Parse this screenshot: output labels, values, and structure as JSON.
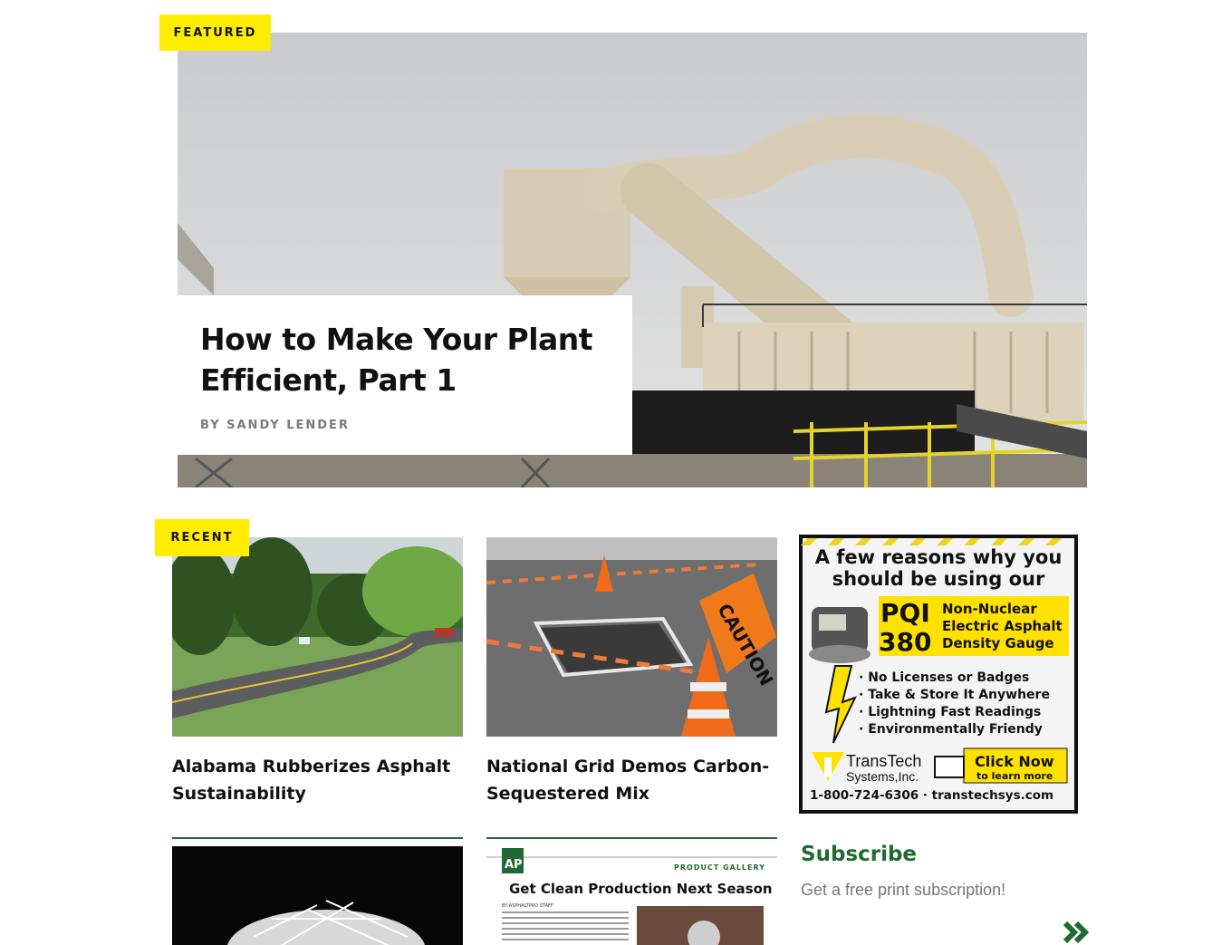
{
  "featured": {
    "tag": "Featured",
    "title": "How to Make Your Plant Efficient, Part 1",
    "byline": "By Sandy Lender"
  },
  "recent": {
    "tag": "Recent",
    "articles": [
      {
        "title": "Alabama Rubberizes Asphalt Sustainability"
      },
      {
        "title": "National Grid Demos Carbon-Sequestered Mix"
      }
    ],
    "more_thumbs": [
      {
        "alt": "fiber-image"
      },
      {
        "badge": "AP",
        "label": "PRODUCT GALLERY",
        "headline": "Get Clean Production Next Season",
        "byline": "BY ASPHALTPRO STAFF"
      }
    ]
  },
  "ad": {
    "headline_line1": "A few reasons why you",
    "headline_line2": "should be using our",
    "model": "PQI",
    "model_number": "380",
    "product_line1": "Non-Nuclear",
    "product_line2": "Electric Asphalt",
    "product_line3": "Density Gauge",
    "bullets": [
      "· No Licenses or Badges",
      "· Take & Store It Anywhere",
      "· Lightning Fast Readings",
      "· Environmentally Friendy"
    ],
    "brand_line1": "TransTech",
    "brand_line2": "Systems,Inc.",
    "cta_line1": "Click Now",
    "cta_line2": "to learn more",
    "contact": "1-800-724-6306 · transtechsys.com"
  },
  "subscribe": {
    "title": "Subscribe",
    "text": "Get a free print subscription!"
  },
  "colors": {
    "tag_yellow": "#ffec00",
    "brand_green": "#1e6a32"
  }
}
